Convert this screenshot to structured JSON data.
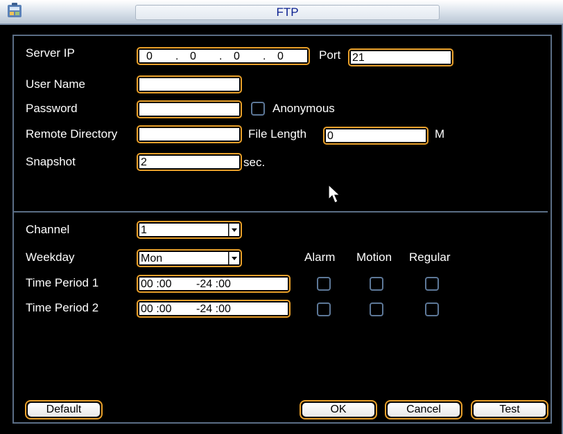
{
  "title": "FTP",
  "icons": {
    "app": "app-icon",
    "cursor": "mouse-pointer-icon",
    "dropdown": "chevron-down-icon"
  },
  "colors": {
    "field_border": "#e9a02a",
    "panel_border": "#5b6e86",
    "title_text": "#0a1f8f",
    "background": "#000000"
  },
  "server": {
    "ip_label": "Server IP",
    "ip_octets": [
      "0",
      "0",
      "0",
      "0"
    ],
    "ip_dots": [
      ".",
      ".",
      "."
    ],
    "port_label": "Port",
    "port_value": "21",
    "username_label": "User Name",
    "username_value": "",
    "password_label": "Password",
    "password_value": "",
    "anonymous_label": "Anonymous",
    "anonymous_checked": false,
    "remote_dir_label": "Remote Directory",
    "remote_dir_value": "",
    "file_length_label": "File Length",
    "file_length_value": "0",
    "file_length_unit": "M",
    "snapshot_label": "Snapshot",
    "snapshot_value": "2",
    "snapshot_unit": "sec."
  },
  "schedule": {
    "channel_label": "Channel",
    "channel_value": "1",
    "weekday_label": "Weekday",
    "weekday_value": "Mon",
    "col_headers": [
      "Alarm",
      "Motion",
      "Regular"
    ],
    "periods": [
      {
        "label": "Time Period 1",
        "value": "00 :00        -24 :00"
      },
      {
        "label": "Time Period 2",
        "value": "00 :00        -24 :00"
      }
    ]
  },
  "buttons": {
    "default": "Default",
    "ok": "OK",
    "cancel": "Cancel",
    "test": "Test"
  }
}
